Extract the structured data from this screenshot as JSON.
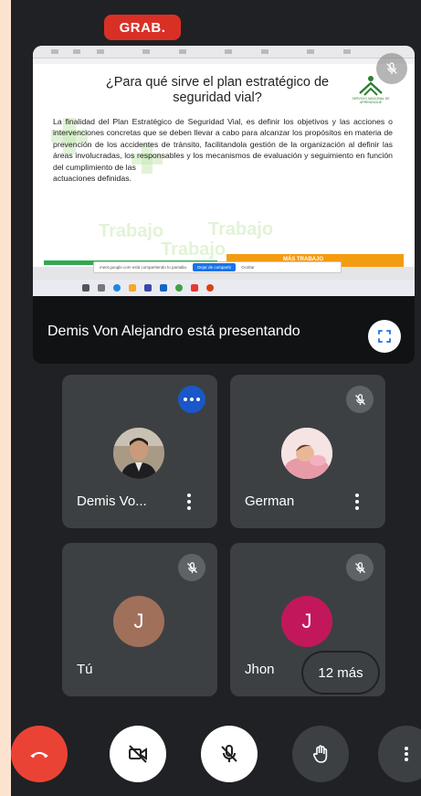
{
  "recording": {
    "label": "GRAB."
  },
  "presentation": {
    "slide_title": "¿Para qué sirve el plan estratégico de seguridad vial?",
    "slide_body": "La finalidad del Plan Estratégico de Seguridad Vial, es definir los objetivos y las acciones o intervenciones concretas que se deben llevar a cabo para alcanzar los propósitos en materia de prevención de los accidentes de tránsito, facilitandola gestión de la organización al definir las áreas involucradas, los responsables y los mecanismos de evaluación y seguimiento en función del cumplimiento de las",
    "slide_body_tail": "actuaciones definidas.",
    "logo_text": "SERVICIO NACIONAL DE APRENDIZAJE",
    "footer_banner": "MÁS TRABAJO",
    "bg_words": [
      "Trabajo",
      "Trabajo",
      "Trabajo"
    ],
    "share_notice": "meet.google.com está compartiendo tu pantalla.",
    "share_stop": "Dejar de compartir",
    "share_hide": "Ocultar",
    "presenter_label": "Demis Von Alejandro está presentando"
  },
  "participants": [
    {
      "name": "Demis Vo...",
      "status": "speaking",
      "avatar": "photo"
    },
    {
      "name": "German",
      "status": "muted",
      "avatar": "photo"
    },
    {
      "name": "Tú",
      "status": "muted",
      "avatar_letter": "J",
      "avatar_color": "#a1705a"
    },
    {
      "name": "Jhon",
      "status": "muted",
      "avatar_letter": "J",
      "avatar_color": "#c2185b"
    }
  ],
  "more_participants": "12 más",
  "controls": {
    "end_call_color": "#ea4335",
    "icons": [
      "phone-hangup-icon",
      "camera-off-icon",
      "mic-off-icon",
      "raise-hand-icon",
      "more-vert-icon"
    ]
  }
}
